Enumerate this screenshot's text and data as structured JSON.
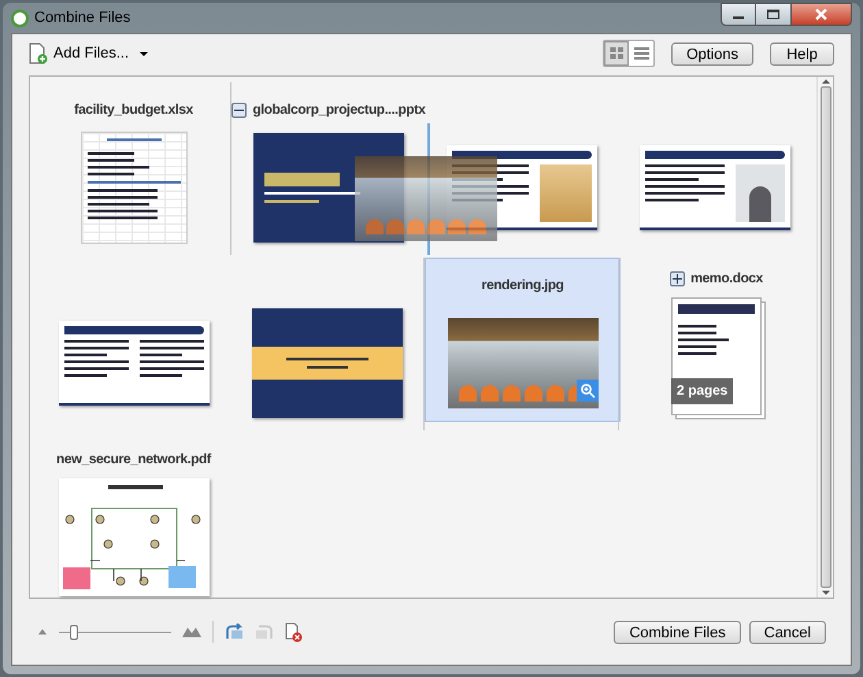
{
  "window": {
    "title": "Combine Files"
  },
  "toolbar": {
    "add_files": "Add Files...",
    "view_modes": [
      {
        "kind": "grid",
        "selected": true
      },
      {
        "kind": "list",
        "selected": false
      }
    ],
    "buttons": [
      "Options",
      "Help"
    ]
  },
  "files": [
    {
      "name": "facility_budget.xlsx",
      "kind": "spreadsheet",
      "selected": false
    },
    {
      "name": "globalcorp_projectup....pptx",
      "kind": "presentation",
      "expanded": true,
      "selected": false,
      "pages": [
        {
          "kind": "title"
        },
        {
          "kind": "bullets_photo"
        },
        {
          "kind": "bullets_person"
        },
        {
          "kind": "bullets_columns"
        },
        {
          "kind": "closing"
        }
      ]
    },
    {
      "name": "rendering.jpg",
      "kind": "image",
      "selected": true,
      "dragging": true
    },
    {
      "name": "memo.docx",
      "kind": "document",
      "expanded": false,
      "selected": false,
      "page_count": "2 pages"
    },
    {
      "name": "new_secure_network.pdf",
      "kind": "diagram",
      "selected": false
    }
  ],
  "zoom": {
    "level": 0.1
  },
  "footer_buttons": [
    "Combine Files",
    "Cancel"
  ]
}
